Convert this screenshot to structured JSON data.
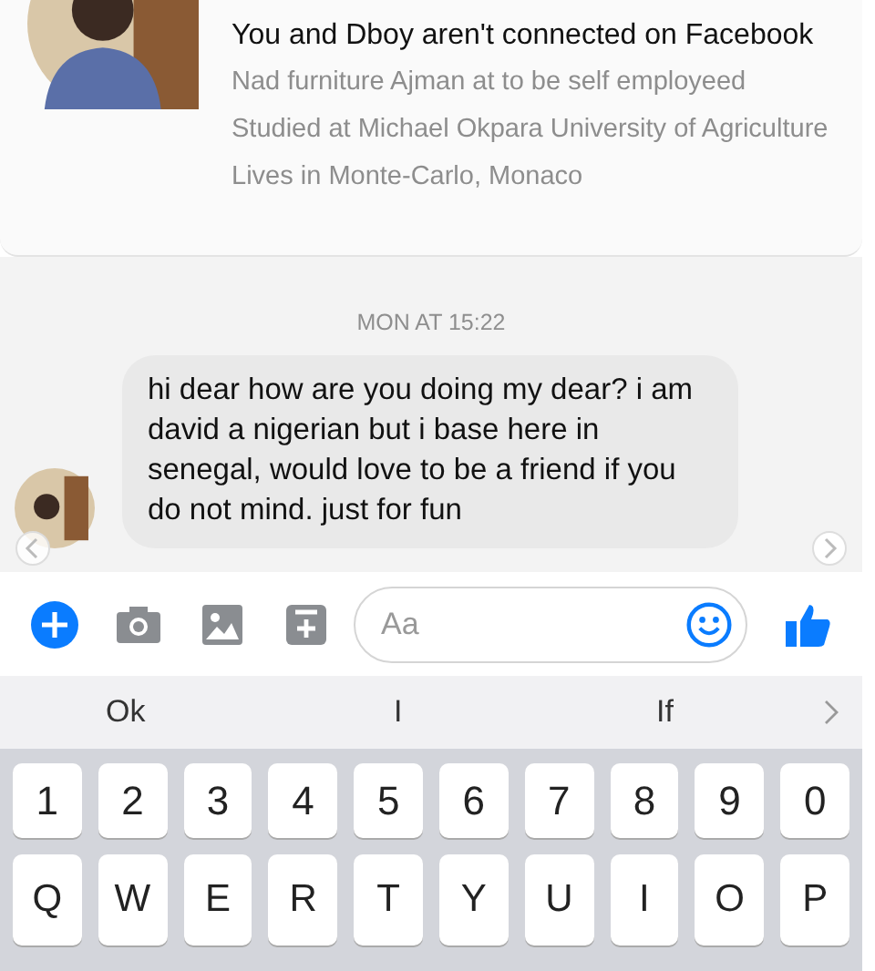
{
  "profile": {
    "connection": "You and Dboy aren't connected on Facebook",
    "details": [
      "Nad furniture Ajman at to be self employeed",
      "Studied at Michael Okpara University of Agriculture",
      "Lives in Monte-Carlo, Monaco"
    ]
  },
  "timestamp": "MON AT 15:22",
  "message": {
    "text": "hi dear how are you doing my dear? i am david a nigerian but i base here in senegal, would love to be a friend if you do not mind. just for fun"
  },
  "composer": {
    "placeholder": "Aa"
  },
  "suggestions": [
    "Ok",
    "I",
    "If"
  ],
  "keyboard": {
    "rows": [
      [
        "1",
        "2",
        "3",
        "4",
        "5",
        "6",
        "7",
        "8",
        "9",
        "0"
      ],
      [
        "Q",
        "W",
        "E",
        "R",
        "T",
        "Y",
        "U",
        "I",
        "O",
        "P"
      ]
    ]
  }
}
